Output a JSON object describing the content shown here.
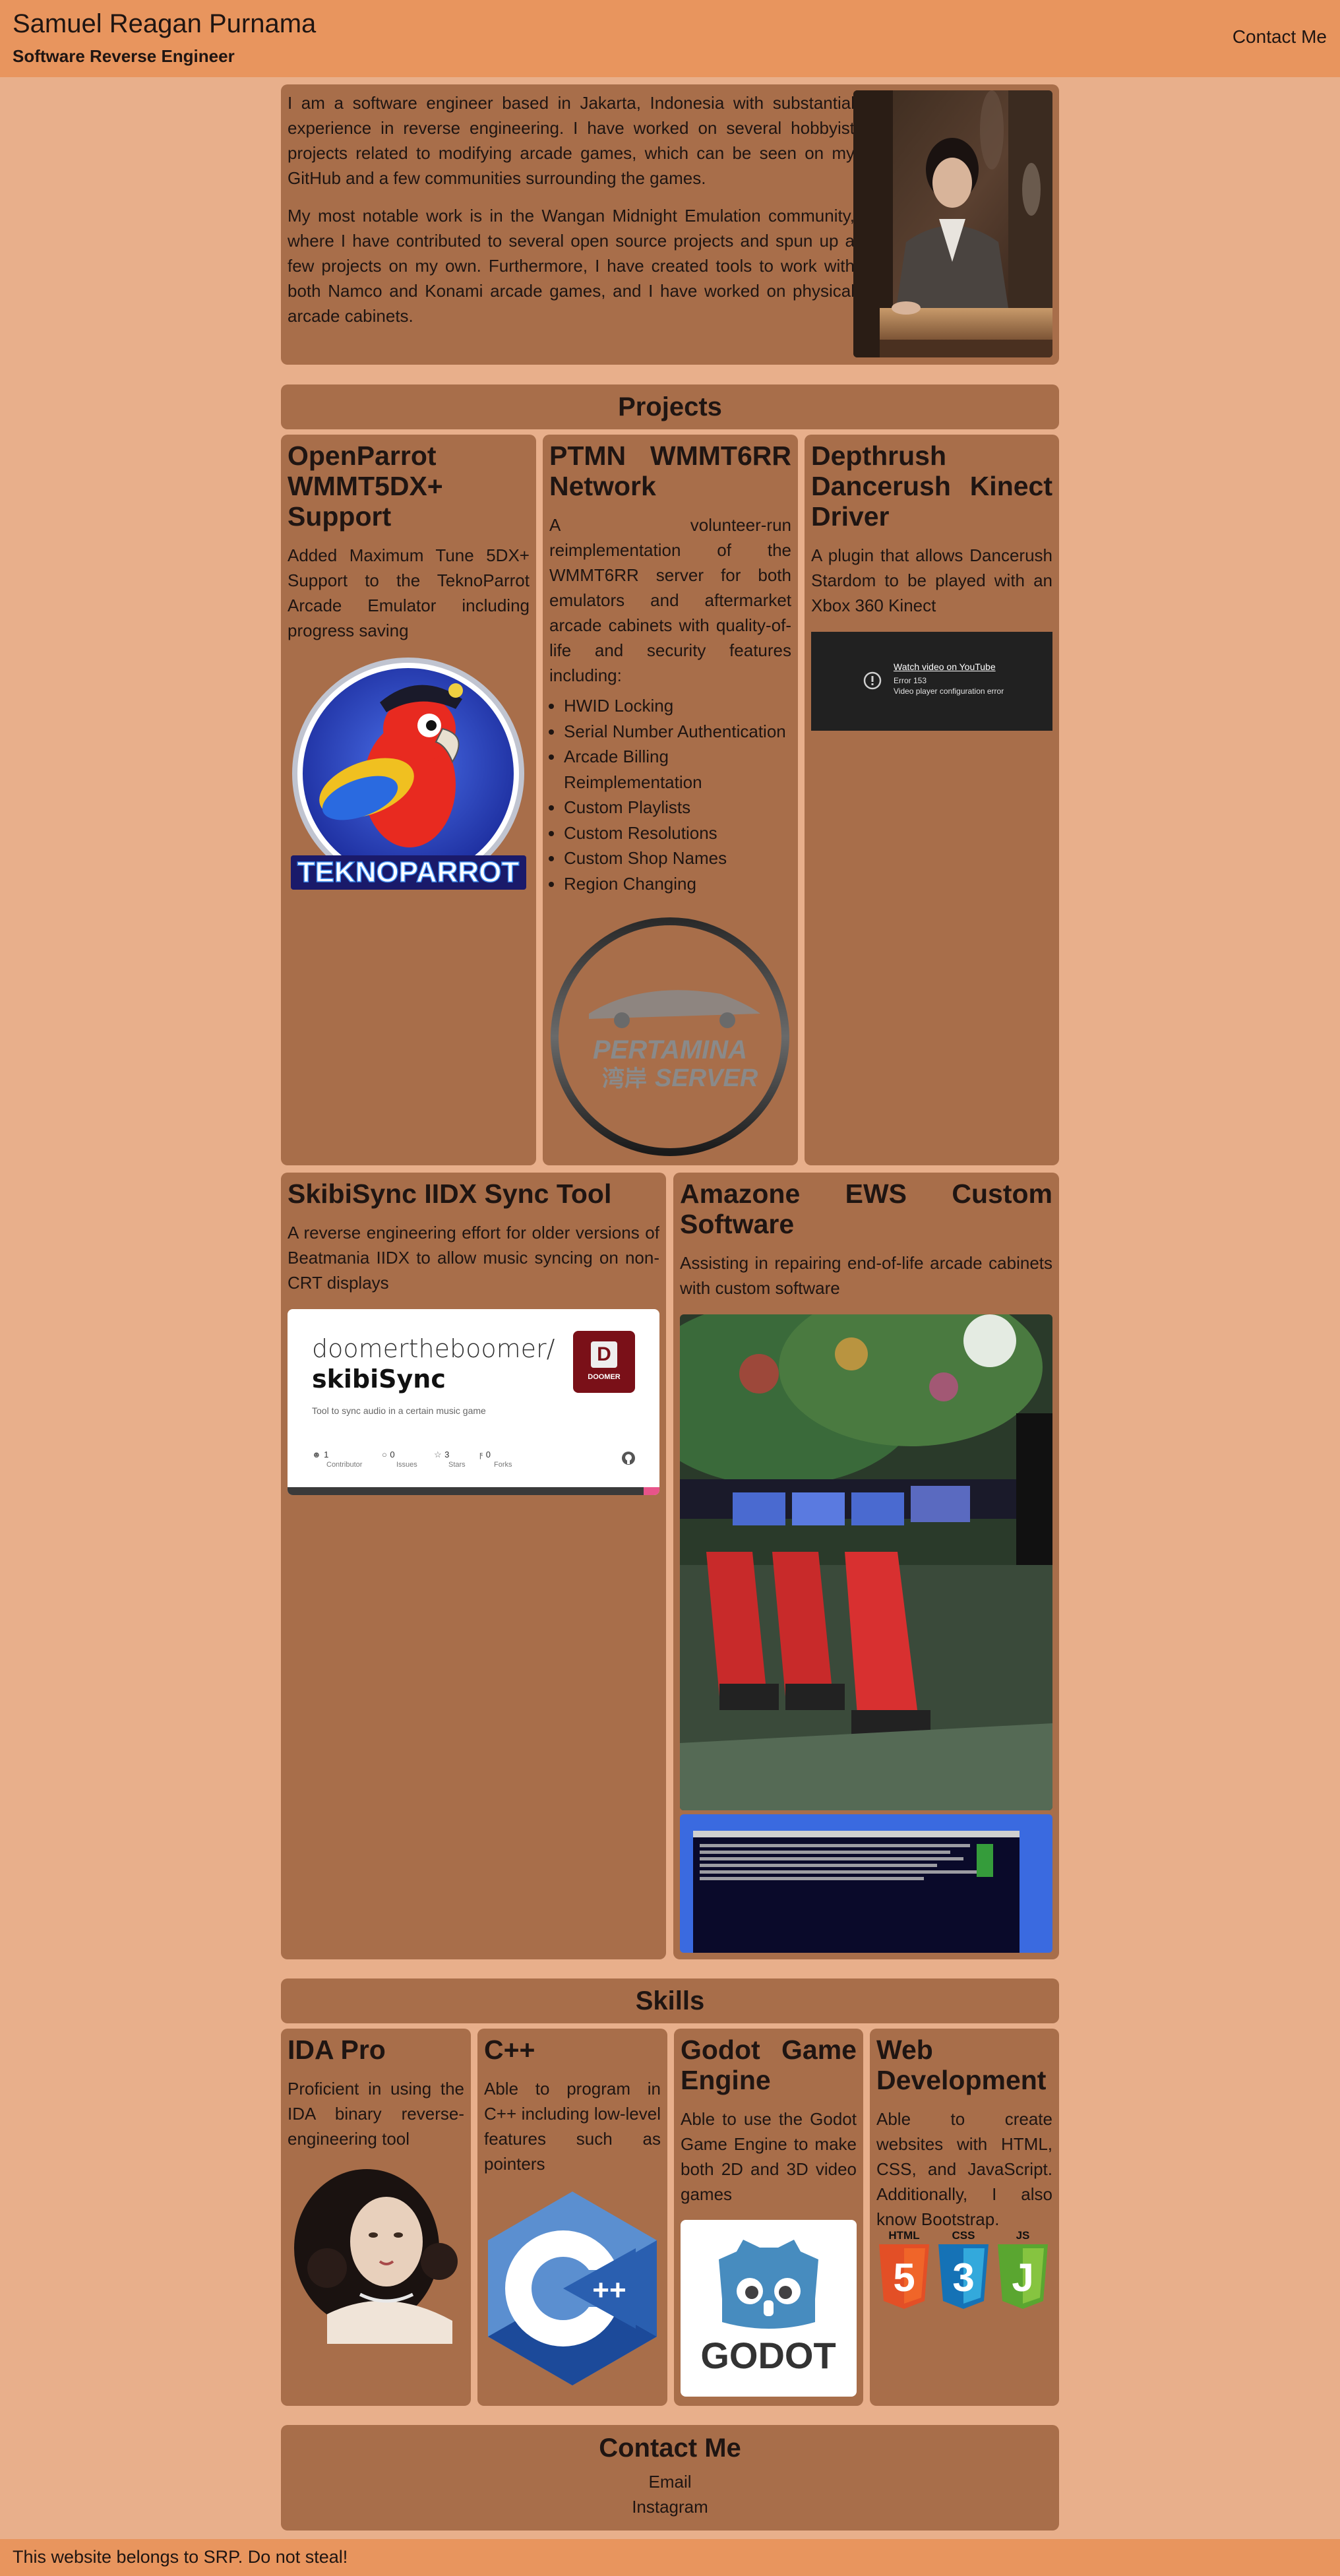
{
  "header": {
    "name": "Samuel Reagan Purnama",
    "subtitle": "Software Reverse Engineer",
    "contact_link": "Contact Me"
  },
  "about": {
    "paragraph1": "I am a software engineer based in Jakarta, Indonesia with substantial experience in reverse engineering. I have worked on several hobbyist projects related to modifying arcade games, which can be seen on my GitHub and a few communities surrounding the games.",
    "paragraph2": "My most notable work is in the Wangan Midnight Emulation community, where I have contributed to several open source projects and spun up a few projects on my own. Furthermore, I have created tools to work with both Namco and Konami arcade games, and I have worked on physical arcade cabinets."
  },
  "projects": {
    "heading": "Projects",
    "openparrot": {
      "title": "OpenParrot WMMT5DX+ Support",
      "description": "Added Maximum Tune 5DX+ Support to the TeknoParrot Arcade Emulator including progress saving",
      "logo_text": "TEKNOPARROT"
    },
    "ptmn": {
      "title": "PTMN WMMT6RR Network",
      "description": "A volunteer-run reimplementation of the WMMT6RR server for both emulators and aftermarket arcade cabinets with quality-of-life and security features including:",
      "features": [
        "HWID Locking",
        "Serial Number Authentication",
        "Arcade Billing Reimplementation",
        "Custom Playlists",
        "Custom Resolutions",
        "Custom Shop Names",
        "Region Changing"
      ],
      "logo_line1": "PERTAMINA",
      "logo_line2a": "湾岸",
      "logo_line2b": "SERVER"
    },
    "depthrush": {
      "title": "Depthrush Dancerush Kinect Driver",
      "description": "A plugin that allows Dancerush Stardom to be played with an Xbox 360 Kinect",
      "video_link": "Watch video on YouTube",
      "video_error": "Error 153",
      "video_error_detail": "Video player configuration error"
    },
    "skibisync": {
      "title": "SkibiSync IIDX Sync Tool",
      "description": "A reverse engineering effort for older versions of Beatmania IIDX to allow music syncing on non-CRT displays",
      "repo_owner": "doomertheboomer/",
      "repo_name": "skibiSync",
      "repo_desc": "Tool to sync audio in a certain music game",
      "stats": [
        {
          "value": "1",
          "label": "Contributor"
        },
        {
          "value": "0",
          "label": "Issues"
        },
        {
          "value": "3",
          "label": "Stars"
        },
        {
          "value": "0",
          "label": "Forks"
        }
      ],
      "avatar_letter": "D",
      "avatar_text": "DOOMER"
    },
    "amazone": {
      "title": "Amazone EWS Custom Software",
      "description": "Assisting in repairing end-of-life arcade cabinets with custom software"
    }
  },
  "skills": {
    "heading": "Skills",
    "items": [
      {
        "title": "IDA Pro",
        "description": "Proficient in using the IDA binary reverse-engineering tool"
      },
      {
        "title": "C++",
        "description": "Able to program in C++ including low-level features such as pointers"
      },
      {
        "title": "Godot Game Engine",
        "description": "Able to use the Godot Game Engine to make both 2D and 3D video games",
        "logo_text": "GODOT"
      },
      {
        "title": "Web Development",
        "description": "Able to create websites with HTML, CSS, and JavaScript. Additionally, I also know Bootstrap.",
        "logos": [
          "HTML",
          "CSS",
          "JS"
        ]
      }
    ]
  },
  "contact": {
    "heading": "Contact Me",
    "links": [
      "Email",
      "Instagram"
    ]
  },
  "footer": {
    "text": "This website belongs to SRP. Do not steal!"
  },
  "colors": {
    "page_background": "#e8af8b",
    "navbar": "#e8955e",
    "card": "#a86e4a",
    "text": "#1f1512"
  }
}
